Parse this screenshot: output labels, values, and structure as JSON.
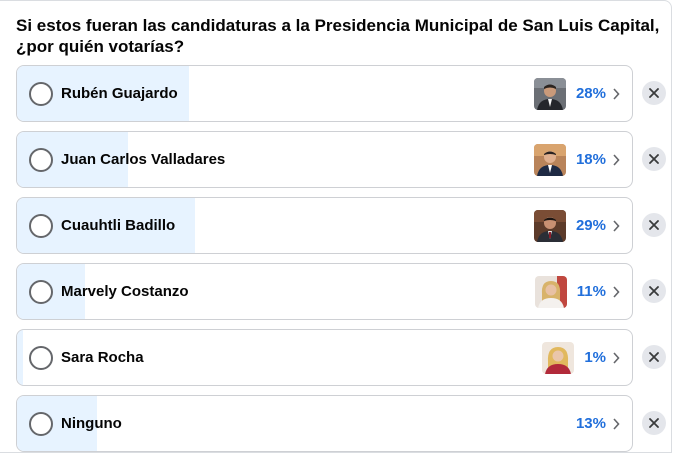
{
  "poll": {
    "question": "Si estos fueran las candidaturas a la Presidencia Municipal de San Luis Capital, ¿por quién votarías?",
    "options": [
      {
        "label": "Rubén Guajardo",
        "percent": "28%",
        "share": 0.28,
        "avatar": "man-suit-photo"
      },
      {
        "label": "Juan Carlos Valladares",
        "percent": "18%",
        "share": 0.18,
        "avatar": "man-suit-photo"
      },
      {
        "label": "Cuauhtli Badillo",
        "percent": "29%",
        "share": 0.29,
        "avatar": "man-suit-photo"
      },
      {
        "label": "Marvely Costanzo",
        "percent": "11%",
        "share": 0.11,
        "avatar": "woman-photo"
      },
      {
        "label": "Sara Rocha",
        "percent": "1%",
        "share": 0.01,
        "avatar": "woman-photo"
      },
      {
        "label": "Ninguno",
        "percent": "13%",
        "share": 0.13,
        "avatar": ""
      }
    ]
  },
  "colors": {
    "fill": "#e7f3ff",
    "percent_text": "#216fdb",
    "border": "#ced0d4",
    "remove_bg": "#e4e6eb"
  }
}
